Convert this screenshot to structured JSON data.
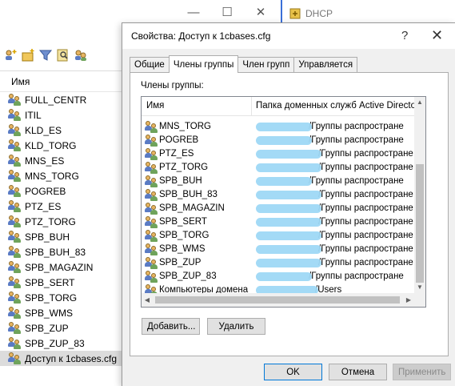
{
  "background_window": {
    "controls": {
      "minimize": "—",
      "maximize": "☐",
      "close": "✕"
    },
    "dhcp_title": "DHCP",
    "list_header": "Имя",
    "items": [
      "FULL_CENTR",
      "ITIL",
      "KLD_ES",
      "KLD_TORG",
      "MNS_ES",
      "MNS_TORG",
      "POGREB",
      "PTZ_ES",
      "PTZ_TORG",
      "SPB_BUH",
      "SPB_BUH_83",
      "SPB_MAGAZIN",
      "SPB_SERT",
      "SPB_TORG",
      "SPB_WMS",
      "SPB_ZUP",
      "SPB_ZUP_83",
      "Доступ к 1cbases.cfg"
    ]
  },
  "dialog": {
    "title": "Свойства: Доступ к 1cbases.cfg",
    "help": "?",
    "close": "✕",
    "tabs": [
      "Общие",
      "Члены группы",
      "Член групп",
      "Управляется"
    ],
    "active_tab": 1,
    "members_label": "Члены группы:",
    "columns": {
      "name": "Имя",
      "folder": "Папка доменных служб Active Directo"
    },
    "rows": [
      {
        "name": "MNS_TORG",
        "folder": "/Группы распростране",
        "mask": "#9ed8f5"
      },
      {
        "name": "POGREB",
        "folder": "/Группы распростране",
        "mask": "#9ed8f5"
      },
      {
        "name": "PTZ_ES",
        "folder": "/Группы распростране",
        "mask": "#9ed8f5"
      },
      {
        "name": "PTZ_TORG",
        "folder": "/Группы распростране",
        "mask": "#9ed8f5"
      },
      {
        "name": "SPB_BUH",
        "folder": "/Группы распростране",
        "mask": "#9ed8f5"
      },
      {
        "name": "SPB_BUH_83",
        "folder": "/Группы распростране",
        "mask": "#9ed8f5"
      },
      {
        "name": "SPB_MAGAZIN",
        "folder": "/Группы распростране",
        "mask": "#9ed8f5"
      },
      {
        "name": "SPB_SERT",
        "folder": "/Группы распростране",
        "mask": "#9ed8f5"
      },
      {
        "name": "SPB_TORG",
        "folder": "/Группы распростране",
        "mask": "#9ed8f5"
      },
      {
        "name": "SPB_WMS",
        "folder": "/Группы распростране",
        "mask": "#9ed8f5"
      },
      {
        "name": "SPB_ZUP",
        "folder": "/Группы распростране",
        "mask": "#9ed8f5"
      },
      {
        "name": "SPB_ZUP_83",
        "folder": "/Группы распростране",
        "mask": "#9ed8f5"
      },
      {
        "name": "Компьютеры домена",
        "folder": "/Users",
        "mask": "#9ed8f5"
      }
    ],
    "buttons": {
      "add": "Добавить...",
      "remove": "Удалить",
      "ok": "OK",
      "cancel": "Отмена",
      "apply": "Применить"
    }
  },
  "colors": {
    "accent": "#0078d7",
    "redaction": "#9ed8f5"
  }
}
